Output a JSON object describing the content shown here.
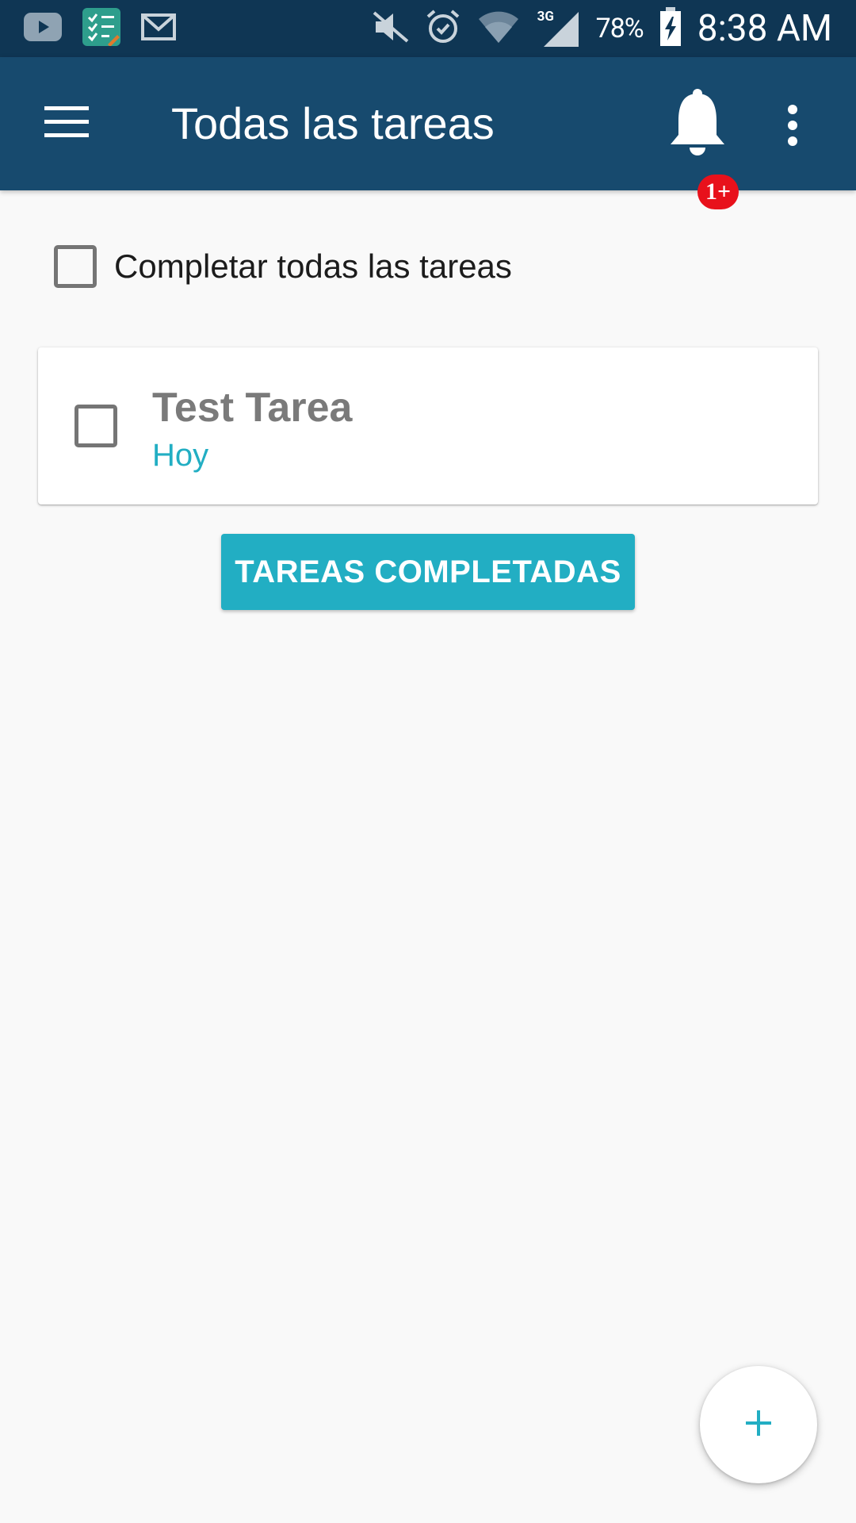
{
  "status_bar": {
    "notification_icons": [
      "youtube-icon",
      "task-app-icon",
      "gmail-icon"
    ],
    "system_icons": [
      "mute-icon",
      "alarm-icon",
      "wifi-icon",
      "signal-3g-icon",
      "battery-charging-icon"
    ],
    "network_label": "3G",
    "battery_percent": "78%",
    "time": "8:38 AM"
  },
  "app_bar": {
    "title": "Todas las tareas",
    "notification_badge": "1+",
    "icons": [
      "menu-icon",
      "bell-icon",
      "more-vert-icon"
    ]
  },
  "select_all": {
    "label": "Completar todas las tareas",
    "checked": false
  },
  "tasks": [
    {
      "title": "Test Tarea",
      "due": "Hoy",
      "checked": false
    }
  ],
  "completed_button": {
    "label": "TAREAS COMPLETADAS"
  },
  "fab": {
    "icon": "add-icon"
  },
  "colors": {
    "status_bar": "#0f3654",
    "app_bar": "#174a6e",
    "accent": "#22aec3",
    "badge": "#e8111b",
    "background": "#f9f9f9"
  }
}
